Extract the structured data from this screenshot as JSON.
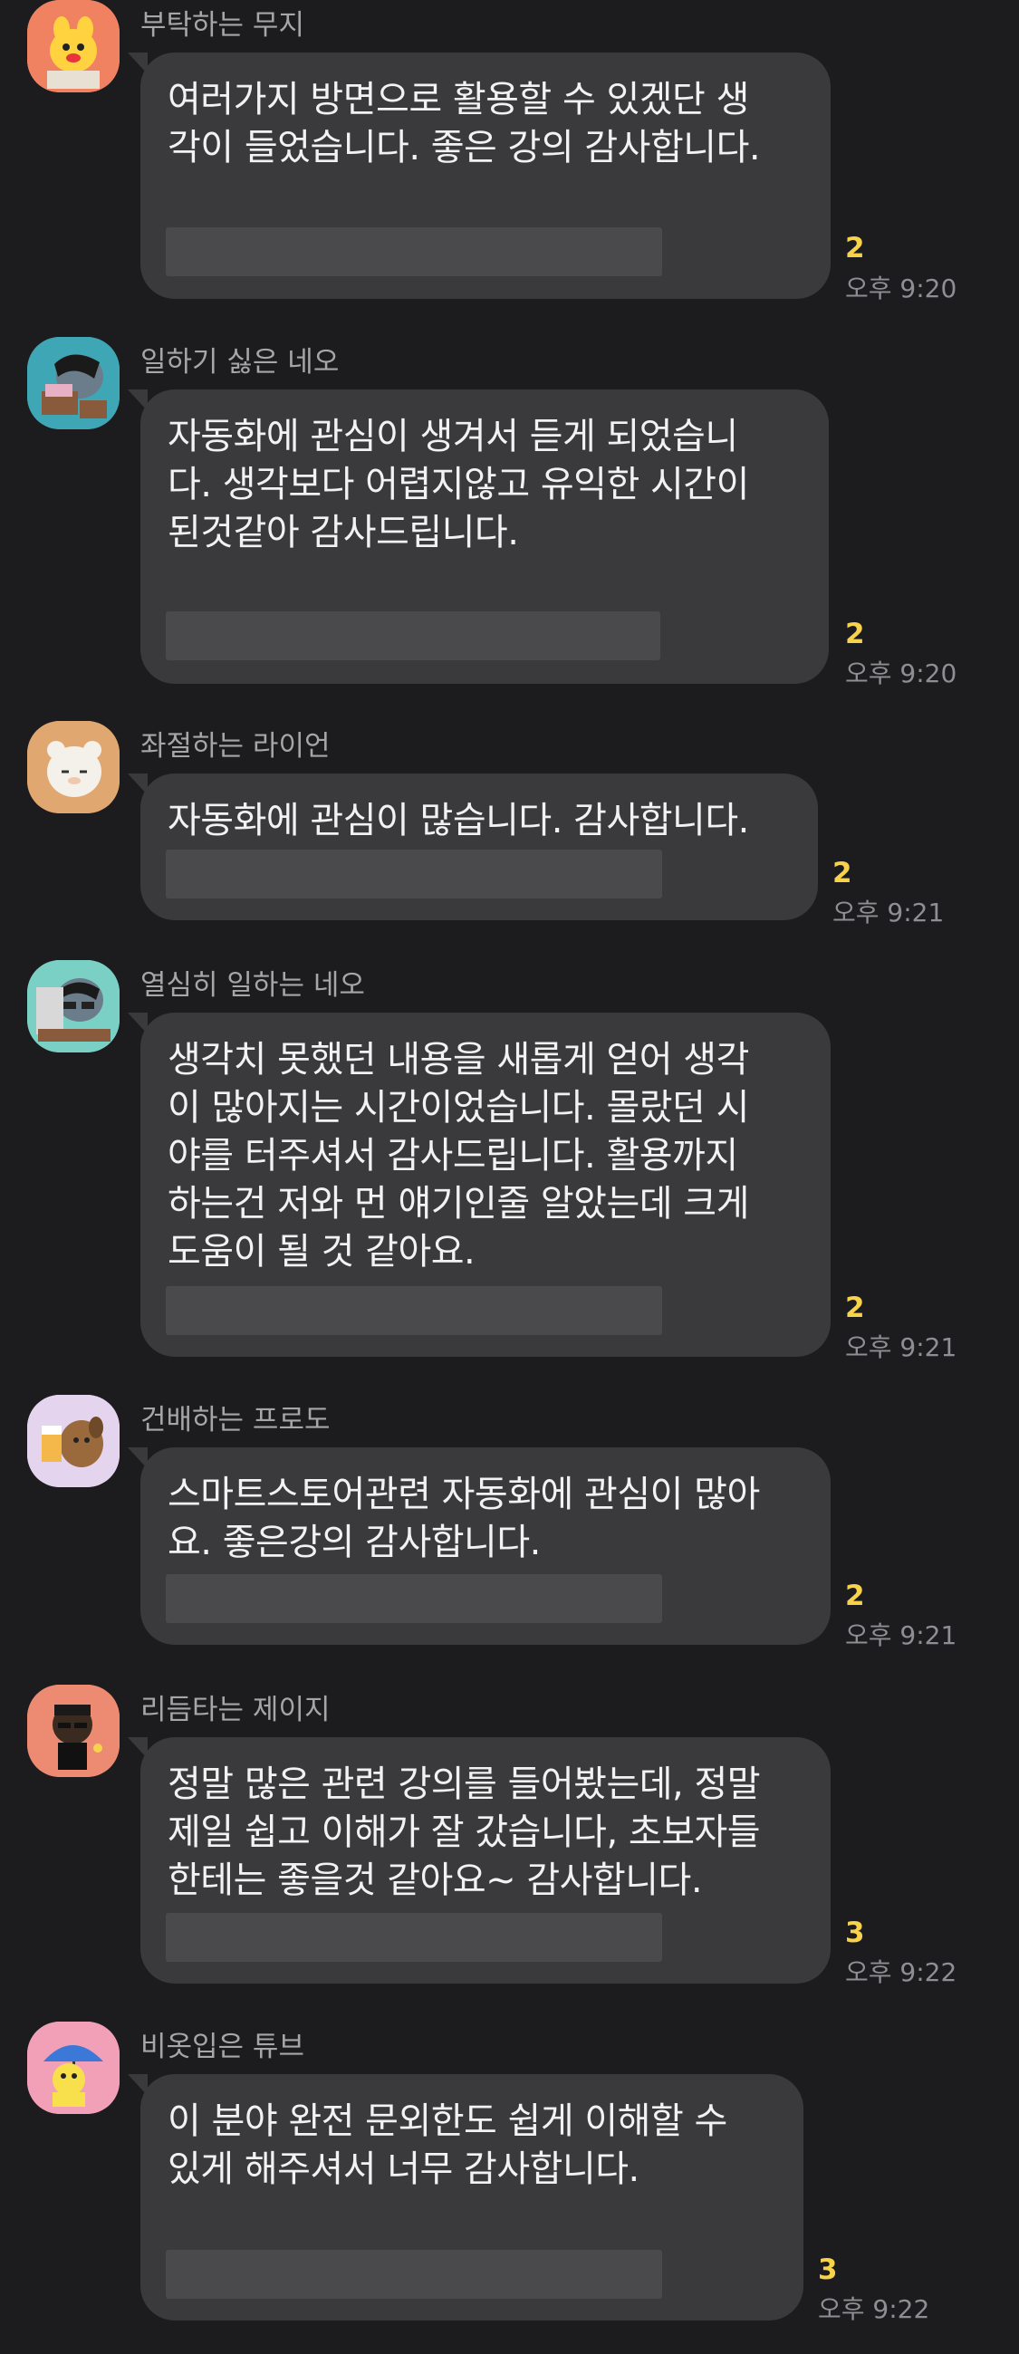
{
  "messages": [
    {
      "sender": "부탁하는 무지",
      "avatar": "muzi-character-icon",
      "text": "여러가지 방면으로 활용할 수 있겠단 생\n각이 들었습니다. 좋은 강의 감사합니다.",
      "unread": "2",
      "time": "오후 9:20"
    },
    {
      "sender": "일하기 싫은 네오",
      "avatar": "neo-working-icon",
      "text": "자동화에 관심이 생겨서 듣게 되었습니\n다. 생각보다 어렵지않고 유익한 시간이\n된것같아  감사드립니다.",
      "unread": "2",
      "time": "오후 9:20"
    },
    {
      "sender": "좌절하는 라이언",
      "avatar": "ryan-frustrated-icon",
      "text": "자동화에 관심이 많습니다. 감사합니다.",
      "unread": "2",
      "time": "오후 9:21"
    },
    {
      "sender": "열심히 일하는 네오",
      "avatar": "neo-hardworking-icon",
      "text": "생각치 못했던 내용을 새롭게 얻어 생각\n이 많아지는 시간이었습니다. 몰랐던 시\n야를 터주셔서 감사드립니다. 활용까지\n하는건 저와 먼 얘기인줄 알았는데 크게\n도움이 될 것 같아요.",
      "unread": "2",
      "time": "오후 9:21"
    },
    {
      "sender": "건배하는 프로도",
      "avatar": "frodo-cheers-icon",
      "text": "스마트스토어관련 자동화에 관심이 많아\n요. 좋은강의 감사합니다.",
      "unread": "2",
      "time": "오후 9:21"
    },
    {
      "sender": "리듬타는 제이지",
      "avatar": "jayg-rhythm-icon",
      "text": "정말 많은 관련 강의를 들어봤는데, 정말\n제일 쉽고 이해가 잘 갔습니다, 초보자들\n한테는 좋을것 같아요~ 감사합니다.",
      "unread": "3",
      "time": "오후 9:22"
    },
    {
      "sender": "비옷입은 튜브",
      "avatar": "tube-raincoat-icon",
      "text": "이 분야 완전 문외한도 쉽게 이해할 수\n있게 해주셔서 너무 감사합니다.",
      "unread": "3",
      "time": "오후 9:22"
    }
  ],
  "colors": {
    "background": "#1c1c1e",
    "bubble": "#3a3a3c",
    "unread_count": "#f7d24c",
    "sender_name": "#a6a6a8"
  }
}
